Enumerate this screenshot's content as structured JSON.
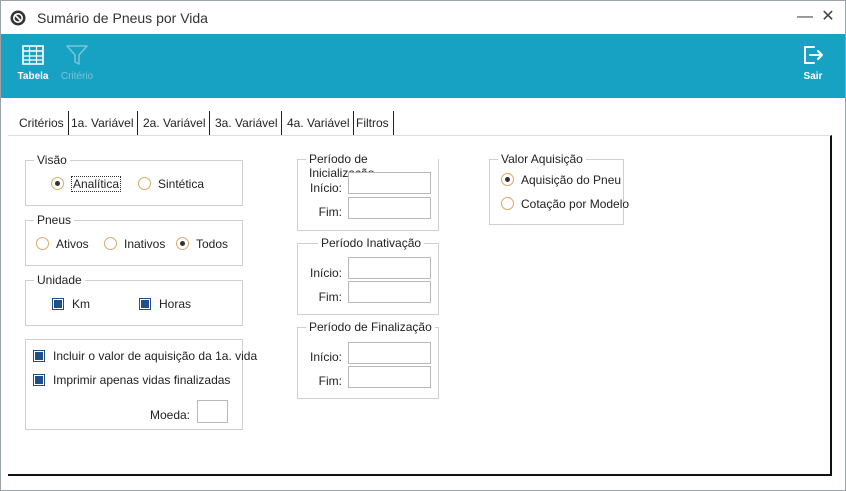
{
  "window": {
    "title": "Sumário de Pneus por Vida"
  },
  "toolbar": {
    "tabela": "Tabela",
    "criterio": "Critério",
    "sair": "Sair"
  },
  "tabs": [
    "Critérios",
    "1a. Variável",
    "2a. Variável",
    "3a. Variável",
    "4a. Variável",
    "Filtros"
  ],
  "visao": {
    "legend": "Visão",
    "options": [
      "Analítica",
      "Sintética"
    ],
    "selected": "Analítica"
  },
  "pneus": {
    "legend": "Pneus",
    "options": [
      "Ativos",
      "Inativos",
      "Todos"
    ],
    "selected": "Todos"
  },
  "unidade": {
    "legend": "Unidade",
    "options": [
      {
        "label": "Km",
        "checked": true
      },
      {
        "label": "Horas",
        "checked": true
      }
    ]
  },
  "opcoes": {
    "incluir": {
      "label": "Incluir o valor de aquisição da 1a. vida",
      "checked": true
    },
    "imprimir": {
      "label": "Imprimir apenas vidas finalizadas",
      "checked": true
    },
    "moeda_label": "Moeda:",
    "moeda_value": ""
  },
  "periodo_inicializacao": {
    "legend": "Período de Inicialização",
    "inicio_label": "Início:",
    "fim_label": "Fim:",
    "inicio": "",
    "fim": ""
  },
  "periodo_inativacao": {
    "legend": "Período Inativação",
    "inicio_label": "Início:",
    "fim_label": "Fim:",
    "inicio": "",
    "fim": ""
  },
  "periodo_finalizacao": {
    "legend": "Período de Finalização",
    "inicio_label": "Início:",
    "fim_label": "Fim:",
    "inicio": "",
    "fim": ""
  },
  "valor_aquisicao": {
    "legend": "Valor Aquisição",
    "options": [
      "Aquisição do Pneu",
      "Cotação por Modelo"
    ],
    "selected": "Aquisição do Pneu"
  },
  "colors": {
    "toolbar": "#17a2c3",
    "radio_border": "#d9a96a",
    "checkbox": "#1f4e8a"
  }
}
